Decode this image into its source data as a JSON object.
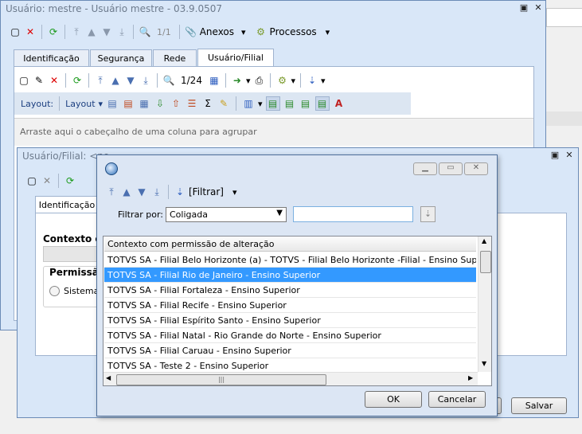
{
  "main_window": {
    "title": "Usuário: mestre - Usuário mestre - 03.9.0507",
    "record_nav": "1/1",
    "anexos_label": "Anexos",
    "processos_label": "Processos",
    "tabs": [
      "Identificação",
      "Segurança",
      "Rede",
      "Usuário/Filial"
    ],
    "sub_record_nav": "1/24",
    "layout_label": "Layout:",
    "layout_menu": "Layout",
    "group_hint": "Arraste aqui o cabeçalho de uma coluna para agrupar"
  },
  "second_window": {
    "title": "Usuário/Filial: <no",
    "tab": "Identificação",
    "contexto_label": "Contexto co",
    "permissao_label": "Permissão",
    "sistema_label": "Sistema",
    "salvar_label": "Salvar"
  },
  "dialog": {
    "filtrar_label": "[Filtrar]",
    "filtrar_por_label": "Filtrar por:",
    "filter_select_value": "Coligada",
    "filter_input_value": "",
    "list_header": "Contexto com permissão de alteração",
    "rows": [
      "TOTVS SA - Filial Belo Horizonte (a) - TOTVS - Filial Belo Horizonte -Filial - Ensino Superior",
      "TOTVS SA - Filial Rio de Janeiro - Ensino Superior",
      "TOTVS SA - Filial Fortaleza - Ensino Superior",
      "TOTVS SA - Filial Recife - Ensino Superior",
      "TOTVS SA - Filial Espírito Santo - Ensino Superior",
      "TOTVS SA - Filial  Natal - Rio Grande do Norte - Ensino Superior",
      "TOTVS SA - Filial Caruau - Ensino Superior",
      "TOTVS SA - Teste 2 - Ensino Superior"
    ],
    "selected_row_index": 1,
    "ok_label": "OK",
    "cancelar_label": "Cancelar"
  },
  "colors": {
    "selection": "#3399ff",
    "window_frame": "#d9e7f8"
  }
}
